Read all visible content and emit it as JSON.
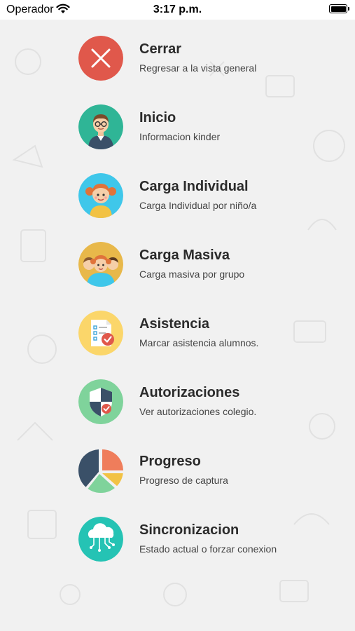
{
  "status_bar": {
    "carrier": "Operador",
    "time": "3:17 p.m."
  },
  "menu": [
    {
      "title": "Cerrar",
      "subtitle": "Regresar a la vista general",
      "icon": "close-icon",
      "color": "#e0584b"
    },
    {
      "title": "Inicio",
      "subtitle": "Informacion kinder",
      "icon": "teacher-avatar-icon",
      "color": "#2fb596"
    },
    {
      "title": "Carga Individual",
      "subtitle": "Carga Individual por niño/a",
      "icon": "girl-avatar-icon",
      "color": "#3fc7ea"
    },
    {
      "title": "Carga Masiva",
      "subtitle": "Carga masiva por grupo",
      "icon": "children-group-icon",
      "color": "#e8b84a"
    },
    {
      "title": "Asistencia",
      "subtitle": "Marcar asistencia alumnos.",
      "icon": "attendance-checklist-icon",
      "color": "#fbd66a"
    },
    {
      "title": "Autorizaciones",
      "subtitle": "Ver autorizaciones colegio.",
      "icon": "shield-check-icon",
      "color": "#7fd39b"
    },
    {
      "title": "Progreso",
      "subtitle": "Progreso de captura",
      "icon": "pie-chart-icon",
      "color": "#ffffff"
    },
    {
      "title": "Sincronizacion",
      "subtitle": "Estado actual o forzar conexion",
      "icon": "cloud-sync-icon",
      "color": "#25c3b4"
    }
  ]
}
